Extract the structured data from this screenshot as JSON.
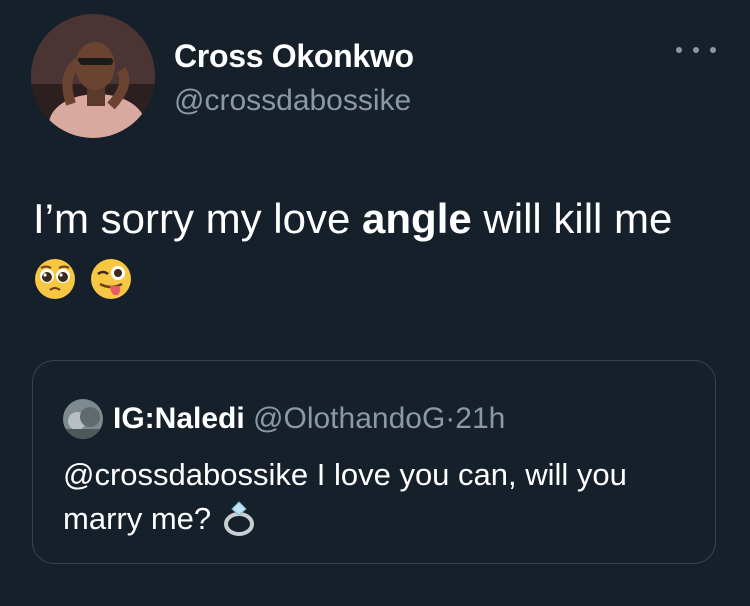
{
  "author": {
    "name": "Cross Okonkwo",
    "handle": "@crossdabossike"
  },
  "tweet": {
    "text_before": "I’m sorry my love ",
    "text_bold": "angle",
    "text_after": " will kill me",
    "emojis": [
      "pleading-face-icon",
      "winking-face-with-tongue-icon"
    ]
  },
  "quoted": {
    "name": "IG:Naledi",
    "handle": "@OlothandoG",
    "separator": "·",
    "time": "21h",
    "text": "@crossdabossike I love you can, will you marry me?",
    "emoji": "ring-icon"
  },
  "colors": {
    "background": "#15202b",
    "secondary_text": "#8b98a5",
    "border": "#38444d"
  }
}
